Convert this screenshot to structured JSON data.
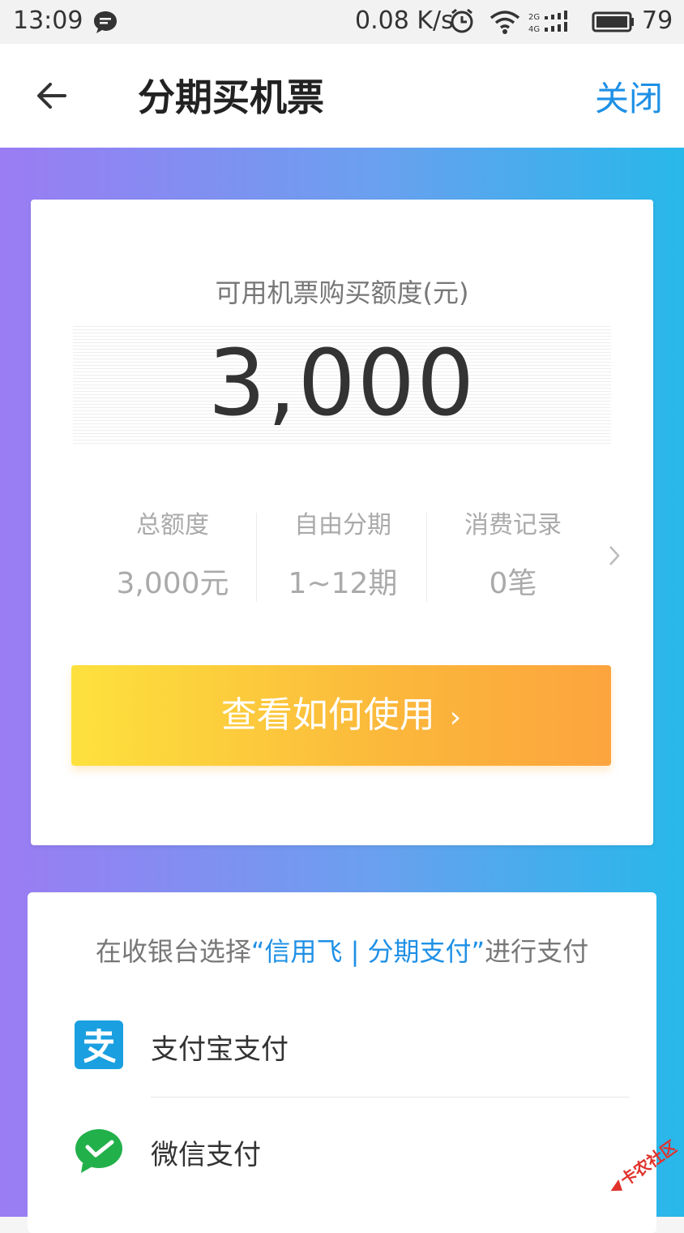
{
  "status_bar": {
    "time": "13:09",
    "speed": "0.08 K/s",
    "battery": "79"
  },
  "nav": {
    "title": "分期买机票",
    "close_label": "关闭"
  },
  "credit": {
    "label": "可用机票购买额度(元)",
    "amount": "3,000",
    "stats": [
      {
        "title": "总额度",
        "value": "3,000元"
      },
      {
        "title": "自由分期",
        "value": "1~12期"
      },
      {
        "title": "消费记录",
        "value": "0笔"
      }
    ],
    "button_label": "查看如何使用",
    "button_arrow": "›"
  },
  "payment": {
    "hint_prefix": "在收银台选择",
    "hint_highlight": "“信用飞 | 分期支付”",
    "hint_suffix": "进行支付",
    "methods": [
      {
        "label": "支付宝支付",
        "icon": "alipay-icon"
      },
      {
        "label": "微信支付",
        "icon": "wechat-pay-icon"
      }
    ]
  },
  "colors": {
    "accent": "#1e90e6",
    "button_gradient_start": "#fde13d",
    "button_gradient_end": "#fca43e",
    "hero_gradient_start": "#9b7cf3",
    "hero_gradient_end": "#27b8ea"
  }
}
